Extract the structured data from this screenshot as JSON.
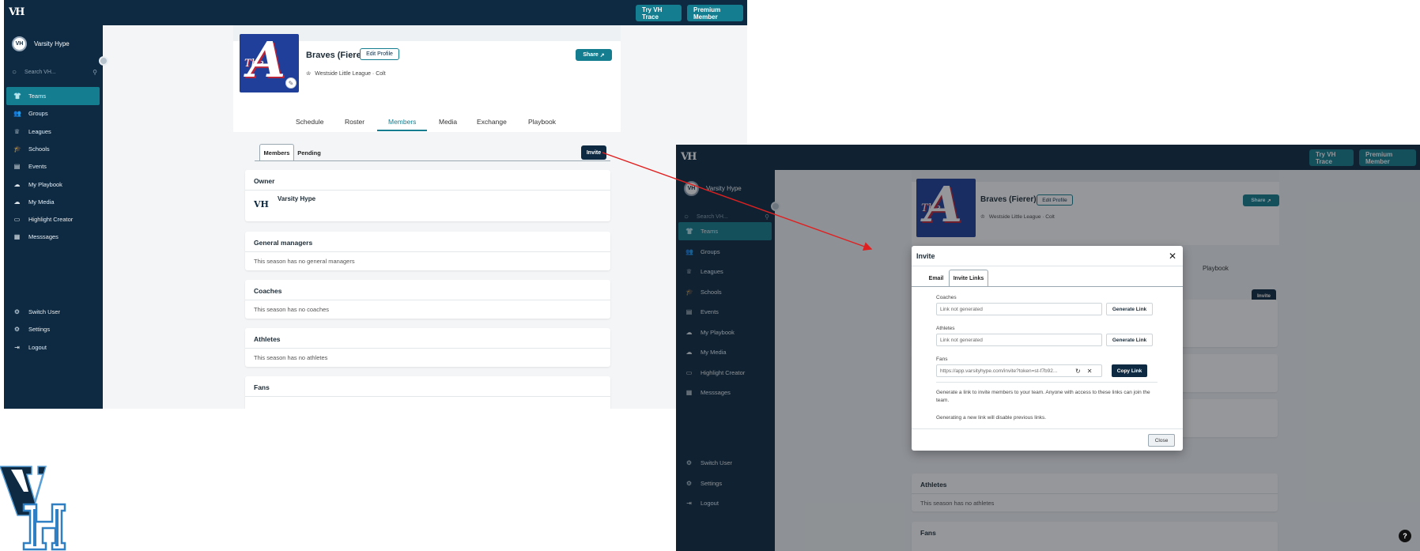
{
  "app": {
    "logo_text": "VH",
    "try_label": "Try VH Trace",
    "premium_label": "Premium Member",
    "user_name": "Varsity Hype",
    "search_placeholder": "Search VH...",
    "brand_color": "#0d2a42",
    "accent_color": "#147d8f"
  },
  "sidebar": {
    "items": [
      {
        "label": "Teams",
        "icon": "shirt-icon",
        "active": true
      },
      {
        "label": "Groups",
        "icon": "users-icon"
      },
      {
        "label": "Leagues",
        "icon": "trophy-icon"
      },
      {
        "label": "Schools",
        "icon": "graduation-cap-icon"
      },
      {
        "label": "Events",
        "icon": "calendar-icon"
      },
      {
        "label": "My Playbook",
        "icon": "cloud-upload-icon"
      },
      {
        "label": "My Media",
        "icon": "cloud-upload-icon"
      },
      {
        "label": "Highlight Creator",
        "icon": "video-icon"
      },
      {
        "label": "Messsages",
        "icon": "chat-icon"
      }
    ],
    "bottom": [
      {
        "label": "Switch User",
        "icon": "gear-icon"
      },
      {
        "label": "Settings",
        "icon": "gear-icon"
      },
      {
        "label": "Logout",
        "icon": "logout-icon"
      }
    ]
  },
  "team": {
    "name": "Braves (Fierer)",
    "edit_label": "Edit Profile",
    "league": "Westside Little League · Colt",
    "share_label": "Share",
    "logo_letter": "A",
    "logo_the": "The"
  },
  "tabs": [
    "Schedule",
    "Roster",
    "Members",
    "Media",
    "Exchange",
    "Playbook"
  ],
  "active_tab": "Members",
  "members": {
    "subtabs": [
      "Members",
      "Pending"
    ],
    "invite_label": "Invite",
    "owner_title": "Owner",
    "owner_name": "Varsity Hype",
    "gm_title": "General managers",
    "gm_empty": "This season has no general managers",
    "coaches_title": "Coaches",
    "coaches_empty": "This season has no coaches",
    "athletes_title": "Athletes",
    "athletes_empty": "This season has no athletes",
    "fans_title": "Fans"
  },
  "modal": {
    "title": "Invite",
    "tabs": [
      "Email",
      "Invite Links"
    ],
    "coaches_label": "Coaches",
    "athletes_label": "Athletes",
    "fans_label": "Fans",
    "not_generated": "Link not generated",
    "generate_label": "Generate Link",
    "fans_link": "https://app.varsityhype.com/invite?token=st-f7b92...",
    "copy_label": "Copy Link",
    "help_1": "Generate a link to invite members to your team. Anyone with access to these links can join the team.",
    "help_2": "Generating a new link will disable previous links.",
    "close_label": "Close",
    "help_symbol": "?"
  }
}
